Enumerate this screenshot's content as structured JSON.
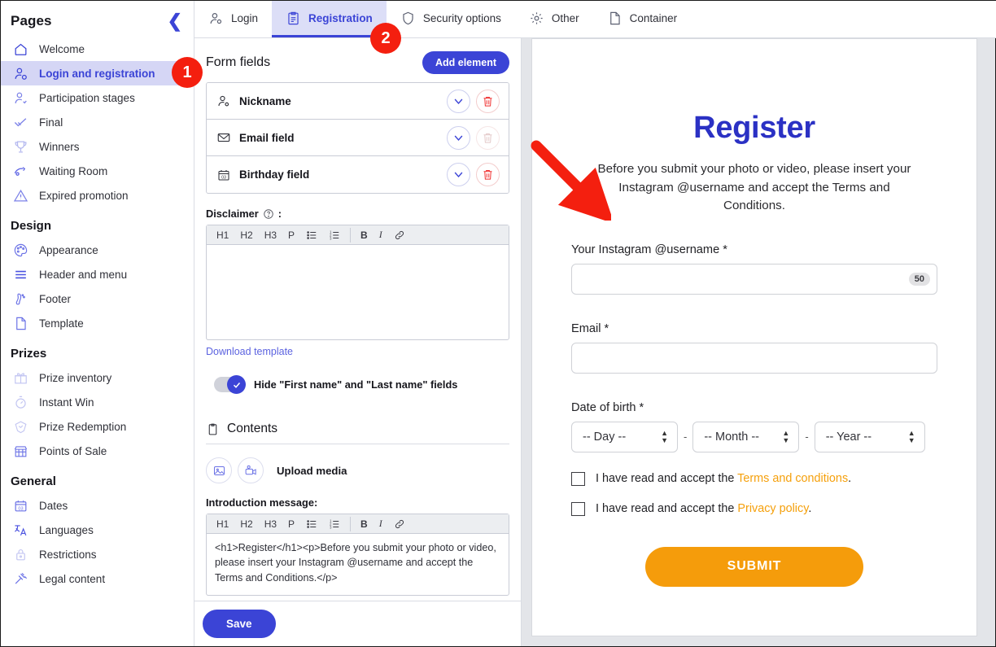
{
  "sidebar": {
    "title": "Pages",
    "collapse_icon": "chevron-left-icon",
    "sections": [
      {
        "label": "",
        "items": [
          {
            "label": "Welcome",
            "icon": "home-icon",
            "active": false
          },
          {
            "label": "Login and registration",
            "icon": "user-gear-icon",
            "active": true
          },
          {
            "label": "Participation stages",
            "icon": "user-add-icon",
            "active": false
          },
          {
            "label": "Final",
            "icon": "check-icon",
            "active": false
          },
          {
            "label": "Winners",
            "icon": "trophy-icon",
            "active": false
          },
          {
            "label": "Waiting Room",
            "icon": "waiting-room-icon",
            "active": false
          },
          {
            "label": "Expired promotion",
            "icon": "warning-triangle-icon",
            "active": false
          }
        ]
      },
      {
        "label": "Design",
        "items": [
          {
            "label": "Appearance",
            "icon": "palette-icon",
            "active": false
          },
          {
            "label": "Header and menu",
            "icon": "menu-lines-icon",
            "active": false
          },
          {
            "label": "Footer",
            "icon": "footprint-icon",
            "active": false
          },
          {
            "label": "Template",
            "icon": "page-icon",
            "active": false
          }
        ]
      },
      {
        "label": "Prizes",
        "items": [
          {
            "label": "Prize inventory",
            "icon": "gift-icon",
            "active": false
          },
          {
            "label": "Instant Win",
            "icon": "stopwatch-icon",
            "active": false
          },
          {
            "label": "Prize Redemption",
            "icon": "ticket-icon",
            "active": false
          },
          {
            "label": "Points of Sale",
            "icon": "store-icon",
            "active": false
          }
        ]
      },
      {
        "label": "General",
        "items": [
          {
            "label": "Dates",
            "icon": "calendar-icon",
            "active": false
          },
          {
            "label": "Languages",
            "icon": "translate-icon",
            "active": false
          },
          {
            "label": "Restrictions",
            "icon": "lock-icon",
            "active": false
          },
          {
            "label": "Legal content",
            "icon": "gavel-icon",
            "active": false
          }
        ]
      }
    ]
  },
  "tabs": [
    {
      "label": "Login",
      "icon": "user-gear-icon",
      "active": false
    },
    {
      "label": "Registration",
      "icon": "clipboard-list-icon",
      "active": true
    },
    {
      "label": "Security options",
      "icon": "shield-icon",
      "active": false
    },
    {
      "label": "Other",
      "icon": "gear-icon",
      "active": false
    },
    {
      "label": "Container",
      "icon": "page-icon",
      "active": false
    }
  ],
  "editor": {
    "form_fields_title": "Form fields",
    "add_element_label": "Add element",
    "fields": [
      {
        "name": "Nickname",
        "icon": "user-gear-icon",
        "delete_enabled": true
      },
      {
        "name": "Email field",
        "icon": "envelope-icon",
        "delete_enabled": false
      },
      {
        "name": "Birthday field",
        "icon": "calendar-icon",
        "delete_enabled": true
      }
    ],
    "disclaimer_label": "Disclaimer",
    "disclaimer_colon": ":",
    "disclaimer_help_icon": "question-circle-icon",
    "disclaimer_value": "",
    "rte_tools": [
      "H1",
      "H2",
      "H3",
      "P"
    ],
    "rte_icons": [
      "bullet-list-icon",
      "numbered-list-icon"
    ],
    "rte_format": [
      "B",
      "I"
    ],
    "rte_link_icon": "link-icon",
    "download_template_label": "Download template",
    "hide_names_toggle": {
      "label": "Hide \"First name\" and \"Last name\" fields",
      "checked": true
    },
    "contents_title": "Contents",
    "contents_icon": "clipboard-icon",
    "upload_media_label": "Upload media",
    "media_icons": [
      "image-icon",
      "video-icon"
    ],
    "intro_message_label": "Introduction message:",
    "intro_message_value": "<h1>Register</h1><p>Before you submit your photo or video, please insert your Instagram @username and accept the Terms and Conditions.</p>",
    "save_label": "Save"
  },
  "preview": {
    "title": "Register",
    "subtitle": "Before you submit your photo or video, please insert your Instagram @username and accept the Terms and Conditions.",
    "instagram_label": "Your Instagram @username *",
    "instagram_value": "",
    "instagram_counter": "50",
    "email_label": "Email *",
    "email_value": "",
    "dob_label": "Date of birth *",
    "dob_day": "-- Day --",
    "dob_month": "-- Month --",
    "dob_year": "-- Year --",
    "dob_separator": "-",
    "terms_prefix": "I have read and accept the ",
    "terms_link": "Terms and conditions",
    "terms_suffix": ".",
    "privacy_prefix": "I have read and accept the ",
    "privacy_link": "Privacy policy",
    "privacy_suffix": ".",
    "terms_checked": false,
    "privacy_checked": false,
    "submit_label": "SUBMIT"
  },
  "annotations": {
    "badge1": "1",
    "badge2": "2",
    "arrow_color": "#f41f0f"
  },
  "colors": {
    "accent": "#3b44d6",
    "accent_title": "#2b31c4",
    "submit_orange": "#f59c0b",
    "link_orange": "#f5a00c",
    "badge_red": "#f41f0f",
    "active_bg": "#d5d6f5"
  }
}
